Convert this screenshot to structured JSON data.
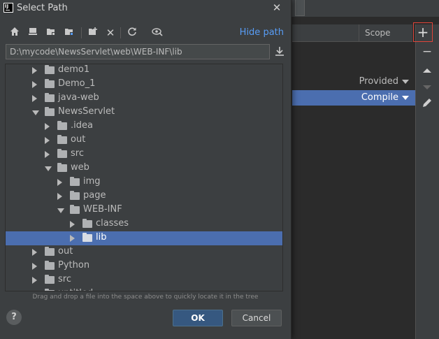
{
  "dialog": {
    "title": "Select Path",
    "hide_path_label": "Hide path",
    "path_value": "D:\\mycode\\NewsServlet\\web\\WEB-INF\\lib",
    "hint": "Drag and drop a file into the space above to quickly locate it in the tree",
    "ok_label": "OK",
    "cancel_label": "Cancel",
    "help_label": "?"
  },
  "toolbar_icons": [
    "home-icon",
    "desktop-icon",
    "project-folder-icon",
    "module-folder-icon",
    "new-folder-icon",
    "delete-icon",
    "refresh-icon",
    "show-hidden-icon"
  ],
  "tree": [
    {
      "label": "demo1",
      "depth": 0,
      "state": "collapsed",
      "selected": false
    },
    {
      "label": "Demo_1",
      "depth": 0,
      "state": "collapsed",
      "selected": false
    },
    {
      "label": "java-web",
      "depth": 0,
      "state": "collapsed",
      "selected": false
    },
    {
      "label": "NewsServlet",
      "depth": 0,
      "state": "expanded",
      "selected": false
    },
    {
      "label": ".idea",
      "depth": 1,
      "state": "collapsed",
      "selected": false
    },
    {
      "label": "out",
      "depth": 1,
      "state": "collapsed",
      "selected": false
    },
    {
      "label": "src",
      "depth": 1,
      "state": "collapsed",
      "selected": false
    },
    {
      "label": "web",
      "depth": 1,
      "state": "expanded",
      "selected": false
    },
    {
      "label": "img",
      "depth": 2,
      "state": "collapsed",
      "selected": false
    },
    {
      "label": "page",
      "depth": 2,
      "state": "collapsed",
      "selected": false
    },
    {
      "label": "WEB-INF",
      "depth": 2,
      "state": "expanded",
      "selected": false
    },
    {
      "label": "classes",
      "depth": 3,
      "state": "collapsed",
      "selected": false
    },
    {
      "label": "lib",
      "depth": 3,
      "state": "collapsed",
      "selected": true
    },
    {
      "label": "out",
      "depth": 0,
      "state": "collapsed",
      "selected": false
    },
    {
      "label": "Python",
      "depth": 0,
      "state": "collapsed",
      "selected": false
    },
    {
      "label": "src",
      "depth": 0,
      "state": "collapsed",
      "selected": false
    },
    {
      "label": "untitled",
      "depth": 0,
      "state": "collapsed",
      "selected": false
    }
  ],
  "background": {
    "scope_header": "Scope",
    "rows": [
      {
        "value": "Provided",
        "selected": false
      },
      {
        "value": "Compile",
        "selected": true
      }
    ],
    "sidebar": {
      "add": "+",
      "remove": "−"
    }
  },
  "colors": {
    "selection": "#4b6eaf",
    "link": "#589df6",
    "ok_button": "#365880",
    "add_highlight": "#e0453a"
  }
}
